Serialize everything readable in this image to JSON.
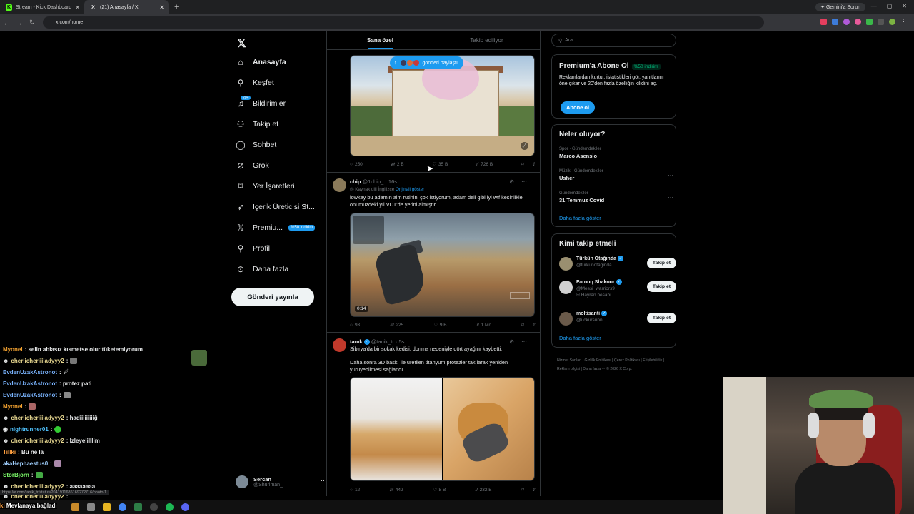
{
  "browser": {
    "tabs": [
      {
        "title": "Stream - Kick Dashboard"
      },
      {
        "title": "(21) Anasayfa / X"
      }
    ],
    "gemini_label": "Gemini'a Sorun",
    "url": "x.com/home"
  },
  "sidebar": {
    "items": [
      {
        "label": "Anasayfa",
        "icon": "home-icon"
      },
      {
        "label": "Keşfet",
        "icon": "search-icon"
      },
      {
        "label": "Bildirimler",
        "icon": "bell-icon",
        "badge": "20+"
      },
      {
        "label": "Takip et",
        "icon": "add-user-icon"
      },
      {
        "label": "Sohbet",
        "icon": "chat-icon"
      },
      {
        "label": "Grok",
        "icon": "grok-icon"
      },
      {
        "label": "Yer İşaretleri",
        "icon": "bookmark-icon"
      },
      {
        "label": "İçerik Üreticisi St...",
        "icon": "rocket-icon"
      },
      {
        "label": "Premiu...",
        "icon": "x-icon",
        "badge": "%50 indirim"
      },
      {
        "label": "Profil",
        "icon": "person-icon"
      },
      {
        "label": "Daha fazla",
        "icon": "more-circle-icon"
      }
    ],
    "post_button": "Gönderi yayınla",
    "account": {
      "name": "Sercan",
      "handle": "@Shuriman_"
    }
  },
  "feed": {
    "tabs": [
      "Sana özel",
      "Takip ediliyor"
    ],
    "share_pill": "gönderi paylaştı",
    "posts": [
      {
        "actions": {
          "replies": "250",
          "reposts": "2 B",
          "likes": "35 B",
          "views": "726 B"
        }
      },
      {
        "name": "chip",
        "handle": "@1chip_",
        "time": "16s",
        "translated": "Kaynak dili İngilizce",
        "translated_link": "Orijinali göster",
        "text": "lowkey bu adamın aim rutinini çok istiyorum, adam deli gibi iyi wtf kesinlikle önümüzdeki yıl VCT'de yerini almıştır",
        "video_time": "0:14",
        "actions": {
          "replies": "93",
          "reposts": "225",
          "likes": "9 B",
          "views": "1 Mn"
        }
      },
      {
        "name": "tanık",
        "handle": "@tanik_tr",
        "time": "5s",
        "text1": "Sibirya'da bir sokak kedisi, donma nedeniyle dört ayağını kaybetti.",
        "text2": "Daha sonra 3D baskı ile üretilen titanyum protezler takılarak yeniden yürüyebilmesi sağlandı.",
        "actions": {
          "replies": "12",
          "reposts": "442",
          "likes": "8 B",
          "views": "232 B"
        }
      }
    ]
  },
  "right": {
    "search_placeholder": "Ara",
    "premium": {
      "title": "Premium'a Abone Ol",
      "badge": "%50 indirim",
      "text": "Reklamlardan kurtul, istatistikleri gör, yanıtlarını öne çıkar ve 20'den fazla özelliğin kilidini aç.",
      "button": "Abone ol"
    },
    "trends": {
      "title": "Neler oluyor?",
      "items": [
        {
          "category": "Spor · Gündemdekiler",
          "topic": "Marco Asensio"
        },
        {
          "category": "Müzik · Gündemdekiler",
          "topic": "Usher"
        },
        {
          "category": "Gündemdekiler",
          "topic": "31 Temmuz Covid"
        }
      ],
      "more": "Daha fazla göster"
    },
    "who_to_follow": {
      "title": "Kimi takip etmeli",
      "users": [
        {
          "name": "Türkün Otağında",
          "handle": "@turkunotaginda",
          "sub": ""
        },
        {
          "name": "Farooq Shakoor",
          "handle": "@Messi_warriors9",
          "sub": "Hayran hesabı"
        },
        {
          "name": "moltisanti",
          "handle": "@uckursunn",
          "sub": ""
        }
      ],
      "follow_label": "Takip et",
      "more": "Daha fazla göster"
    },
    "footer": "Hizmet Şartları | Gizlilik Politikası | Çerez Politikası | Erişilebilirlik | Reklam bilgisi | Daha fazla ··· © 2026 X Corp."
  },
  "chat": {
    "messages": [
      {
        "user": "Myonel",
        "text": ": selin ablasız kısmetse olur tüketemiyorum",
        "color": "#f0a030"
      },
      {
        "user": "cheriicheriiiladyyy2",
        "text": ":",
        "color": "#e8d890"
      },
      {
        "user": "EvdenUzakAstronot",
        "text": ":",
        "color": "#7ab4ff"
      },
      {
        "user": "EvdenUzakAstronot",
        "text": ": protez pati",
        "color": "#7ab4ff"
      },
      {
        "user": "EvdenUzakAstronot",
        "text": ":",
        "color": "#7ab4ff"
      },
      {
        "user": "Myonel",
        "text": ":",
        "color": "#f0a030"
      },
      {
        "user": "cheriicheriiiladyyy2",
        "text": ": hadiiiiiiiiiğ",
        "color": "#e8d890"
      },
      {
        "user": "nightrunner01",
        "text": ":",
        "color": "#4fc3ff"
      },
      {
        "user": "cheriicheriiiladyyy2",
        "text": ": Izleyelilllim",
        "color": "#e8d890"
      },
      {
        "user": "Tillki",
        "text": ": Bu ne la",
        "color": "#ffa040"
      },
      {
        "user": "akaHephaestus0",
        "text": ":",
        "color": "#a0d0ff"
      },
      {
        "user": "StorBjorn",
        "text": ":",
        "color": "#7cfc6a"
      },
      {
        "user": "cheriicheriiiladyyy2",
        "text": ": aaaaaaaa",
        "color": "#e8d890"
      },
      {
        "user": "cheriicheriiiladyyy2",
        "text": ":",
        "color": "#e8d890"
      }
    ],
    "status_url": "https://x.com/tanik_tr/status/2041911686169272716/photo/1",
    "meld_status": "Mevlanaya bağladı"
  }
}
